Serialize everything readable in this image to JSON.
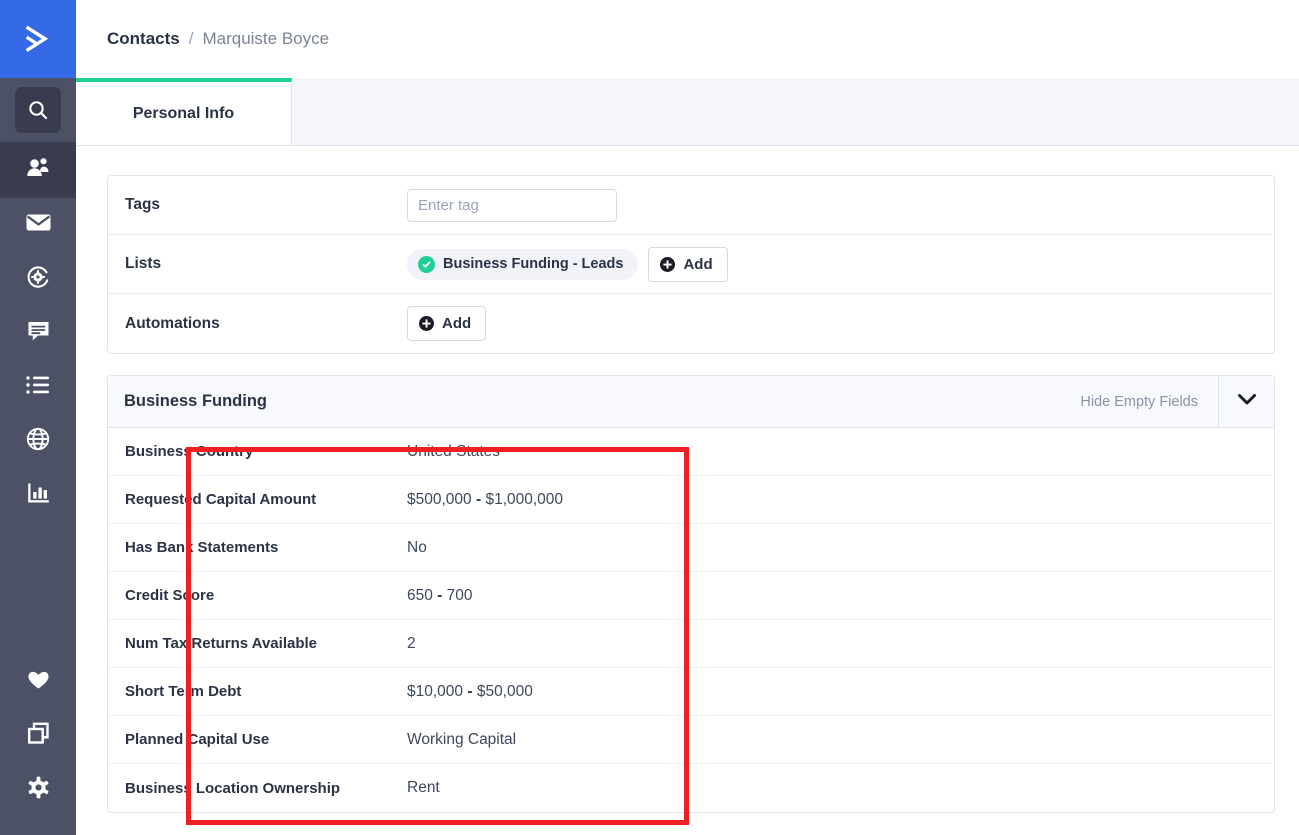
{
  "brand": {
    "logo_icon": "activecampaign-chevron-logo",
    "logo_bg": "#356ae6",
    "accent_green": "#1ecd97",
    "annotation_color": "#ee2024"
  },
  "sidebar": {
    "top_items": [
      {
        "icon": "search-icon",
        "name": "sidebar-item-search",
        "active": false
      },
      {
        "icon": "contacts-icon",
        "name": "sidebar-item-contacts",
        "active": true
      },
      {
        "icon": "envelope-icon",
        "name": "sidebar-item-campaigns",
        "active": false
      },
      {
        "icon": "automations-gear-icon",
        "name": "sidebar-item-automations",
        "active": false
      },
      {
        "icon": "chat-bubble-icon",
        "name": "sidebar-item-conversations",
        "active": false
      },
      {
        "icon": "list-icon",
        "name": "sidebar-item-lists",
        "active": false
      },
      {
        "icon": "globe-icon",
        "name": "sidebar-item-website",
        "active": false
      },
      {
        "icon": "bar-chart-icon",
        "name": "sidebar-item-reports",
        "active": false
      }
    ],
    "bottom_items": [
      {
        "icon": "heart-icon",
        "name": "sidebar-item-favorites"
      },
      {
        "icon": "apps-copy-icon",
        "name": "sidebar-item-apps"
      },
      {
        "icon": "settings-gear-icon",
        "name": "sidebar-item-settings"
      }
    ]
  },
  "breadcrumb": {
    "root": "Contacts",
    "separator": "/",
    "current": "Marquiste Boyce"
  },
  "tabs": [
    {
      "label": "Personal Info",
      "active": true
    }
  ],
  "details_card": {
    "tags": {
      "label": "Tags",
      "input_value": "",
      "placeholder": "Enter tag"
    },
    "lists": {
      "label": "Lists",
      "chips": [
        {
          "name": "Business Funding - Leads",
          "status_icon": "check-circle-icon"
        }
      ],
      "add_label": "Add"
    },
    "automations": {
      "label": "Automations",
      "add_label": "Add"
    }
  },
  "section": {
    "title": "Business Funding",
    "hide_empty_label": "Hide Empty Fields",
    "collapse_icon": "chevron-down-icon",
    "fields": [
      {
        "label": "Business Country",
        "value": "United States"
      },
      {
        "label": "Requested Capital Amount",
        "value": "$500,000 - $1,000,000"
      },
      {
        "label": "Has Bank Statements",
        "value": "No"
      },
      {
        "label": "Credit Score",
        "value": "650 - 700"
      },
      {
        "label": "Num Tax Returns Available",
        "value": "2"
      },
      {
        "label": "Short Term Debt",
        "value": "$10,000 - $50,000"
      },
      {
        "label": "Planned Capital Use",
        "value": "Working Capital"
      },
      {
        "label": "Business Location Ownership",
        "value": "Rent"
      }
    ]
  }
}
